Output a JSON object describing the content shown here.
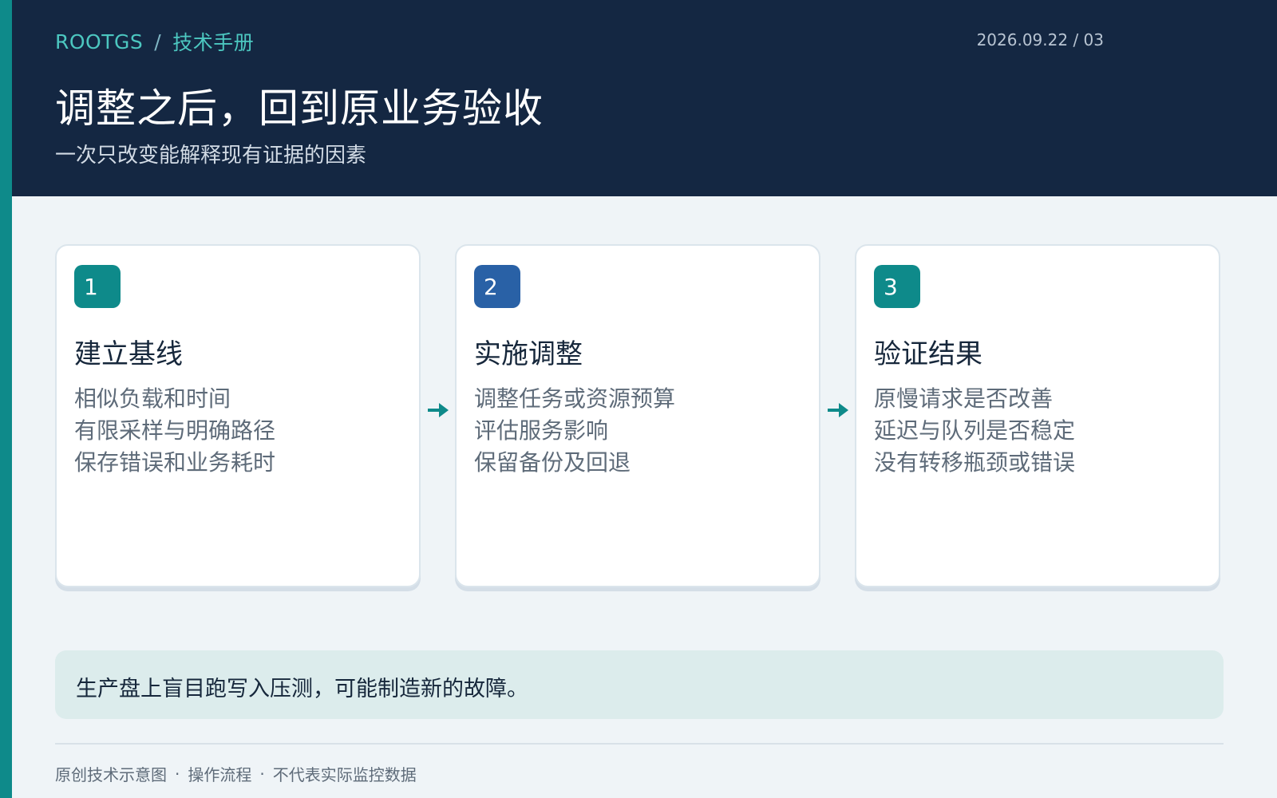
{
  "header": {
    "brand": "ROOTGS",
    "breadcrumb_sep": "/",
    "section": "技术手册",
    "date_page": "2026.09.22 / 03",
    "title": "调整之后，回到原业务验收",
    "subtitle": "一次只改变能解释现有证据的因素"
  },
  "steps": [
    {
      "number": "1",
      "title": "建立基线",
      "lines": [
        "相似负载和时间",
        "有限采样与明确路径",
        "保存错误和业务耗时"
      ],
      "badge_color": "#0e8a8a"
    },
    {
      "number": "2",
      "title": "实施调整",
      "lines": [
        "调整任务或资源预算",
        "评估服务影响",
        "保留备份及回退"
      ],
      "badge_color": "#2961a6"
    },
    {
      "number": "3",
      "title": "验证结果",
      "lines": [
        "原慢请求是否改善",
        "延迟与队列是否稳定",
        "没有转移瓶颈或错误"
      ],
      "badge_color": "#0e8a8a"
    }
  ],
  "arrow_icon": "arrow-right-icon",
  "note": {
    "text": "生产盘上盲目跑写入压测，可能制造新的故障。"
  },
  "footer": {
    "items": [
      "原创技术示意图",
      "操作流程",
      "不代表实际监控数据"
    ],
    "separator": "·"
  },
  "colors": {
    "accent": "#0e8a8a",
    "header_bg": "#142742",
    "brand_text": "#4cc7c0"
  }
}
